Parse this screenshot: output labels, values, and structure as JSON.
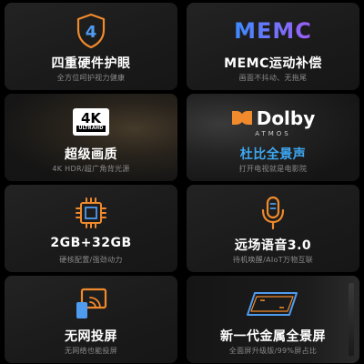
{
  "colors": {
    "accent_orange": "#f08a2c",
    "accent_blue": "#3ea8f2",
    "memc_gradient_start": "#3d8bff",
    "memc_gradient_end": "#a05cf6",
    "card_background": "#1d1d1d",
    "subtitle_gray": "#8a8a8a"
  },
  "cards": [
    {
      "icon": "shield-4-icon",
      "icon_text": "4",
      "title": "四重硬件护眼",
      "subtitle": "全方位呵护视力健康"
    },
    {
      "icon": "memc-logo",
      "icon_text": "MEMC",
      "title": "MEMC运动补偿",
      "subtitle": "画面不抖动、无拖尾"
    },
    {
      "icon": "4k-ultrahd-badge",
      "icon_text": "4K",
      "icon_subtext": "ULTRAHD",
      "title": "超级画质",
      "subtitle": "4K HDR/超广角背光源"
    },
    {
      "icon": "dolby-atmos-logo",
      "icon_text": "Dolby",
      "icon_subtext": "ATMOS",
      "title": "杜比全景声",
      "subtitle": "打开电视就是电影院"
    },
    {
      "icon": "chip-icon",
      "title": "2GB+32GB",
      "subtitle": "硬核配置/强劲动力"
    },
    {
      "icon": "microphone-icon",
      "title": "远场语音3.0",
      "subtitle": "待机唤醒/AIoT万物互联"
    },
    {
      "icon": "screen-cast-icon",
      "title": "无网投屏",
      "subtitle": "无网络也能投屏"
    },
    {
      "icon": "full-screen-frame-icon",
      "title": "新一代金属全景屏",
      "subtitle": "全面屏升级版/99%屏占比"
    }
  ]
}
